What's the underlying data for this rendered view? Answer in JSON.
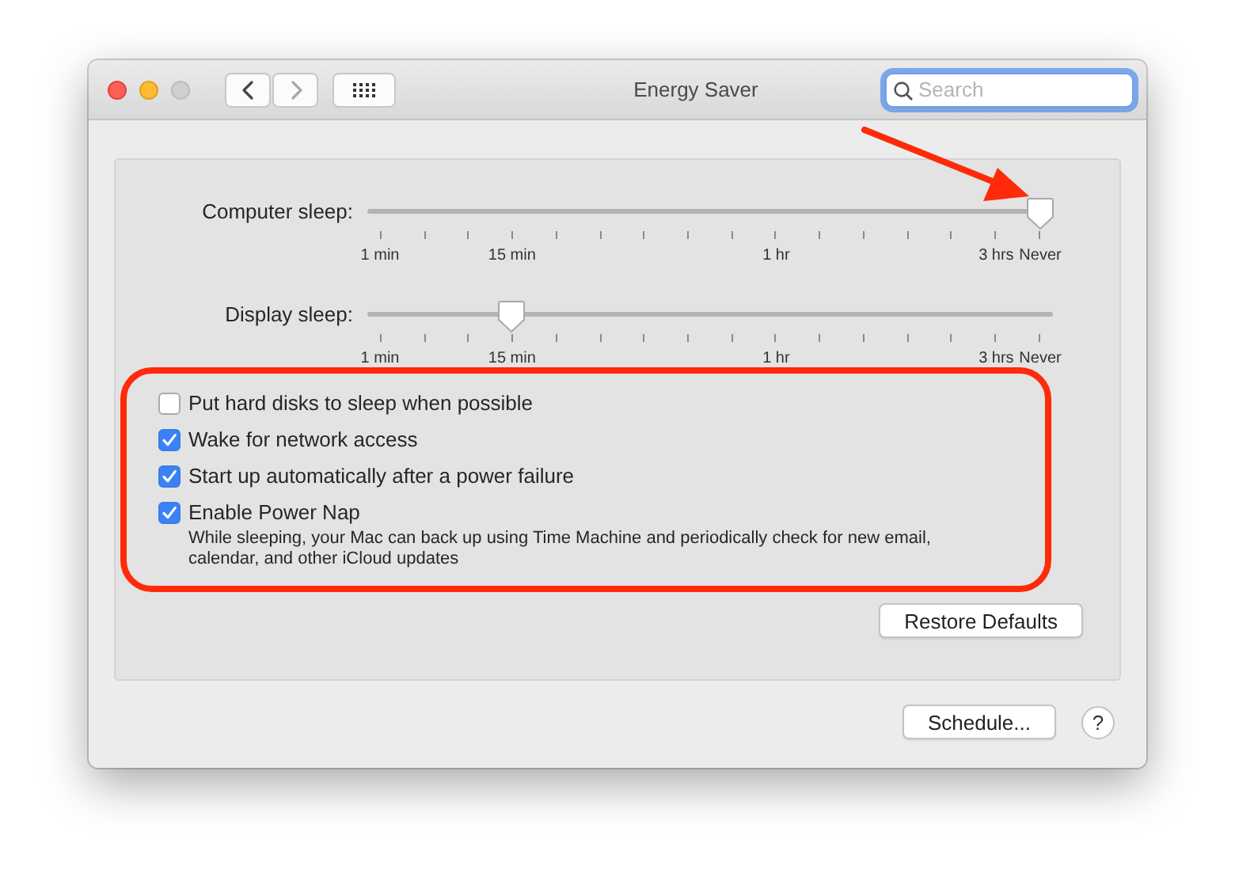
{
  "window": {
    "title": "Energy Saver"
  },
  "navigation": [
    {
      "kind": "back",
      "disabled": false
    },
    {
      "kind": "forward",
      "disabled": true
    }
  ],
  "search": {
    "placeholder": "Search",
    "focused": true
  },
  "sliders": [
    {
      "label": "Computer sleep:",
      "level": 1,
      "ticks": [
        "1 min",
        "15 min",
        "1 hr",
        "3 hrs",
        "Never"
      ]
    },
    {
      "label": "Display sleep:",
      "level": 0.2,
      "ticks": [
        "1 min",
        "15 min",
        "1 hr",
        "3 hrs",
        "Never"
      ]
    }
  ],
  "checkboxes": [
    {
      "label": "Put hard disks to sleep when possible",
      "checked": false
    },
    {
      "label": "Wake for network access",
      "checked": true
    },
    {
      "label": "Start up automatically after a power failure",
      "checked": true
    },
    {
      "label": "Enable Power Nap",
      "checked": true,
      "description": "While sleeping, your Mac can back up using Time Machine and periodically check for new email, calendar, and other iCloud updates"
    }
  ],
  "restore_button": "Restore Defaults",
  "schedule_button": "Schedule...",
  "help_button": "?"
}
